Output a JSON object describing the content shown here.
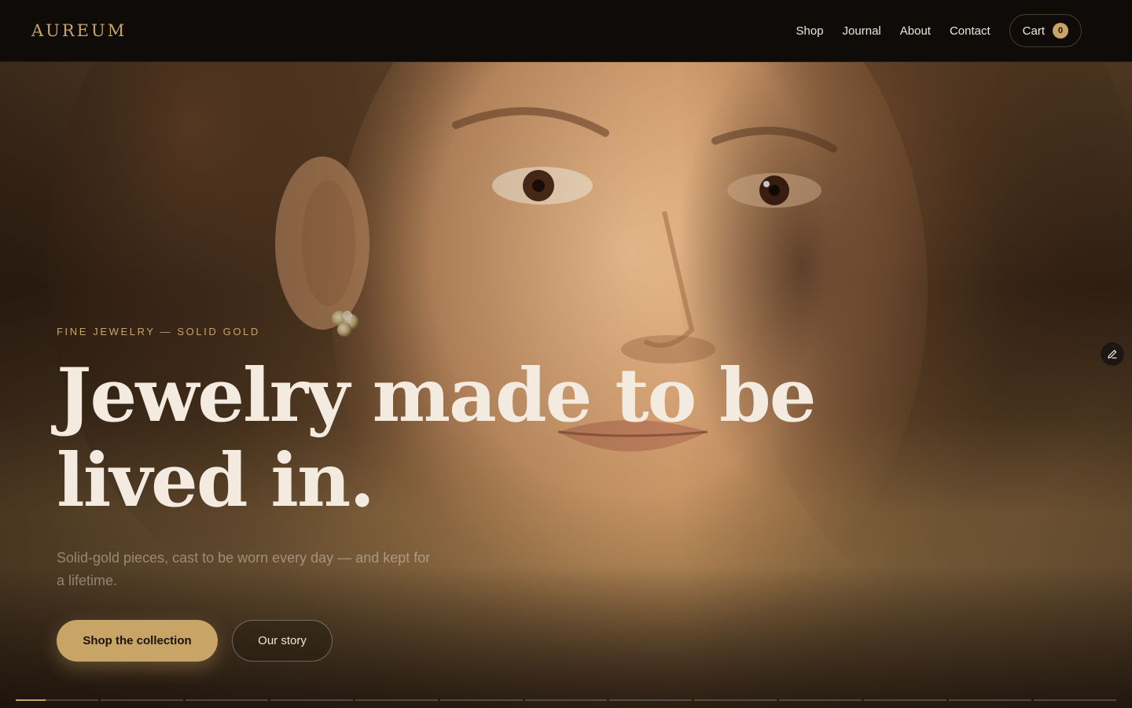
{
  "brand": {
    "logo": "AUREUM",
    "accent": "#c9a467",
    "background": "#0f0b08"
  },
  "nav": {
    "links": [
      "Shop",
      "Journal",
      "About",
      "Contact"
    ],
    "cart_label": "Cart",
    "cart_count": "0"
  },
  "hero": {
    "eyebrow": "FINE JEWELRY — SOLID GOLD",
    "headline": "Jewelry made to be lived in.",
    "subtitle": "Solid-gold pieces, cast to be worn every day — and kept for a lifetime.",
    "primary_cta": "Shop the collection",
    "secondary_cta": "Our story",
    "image": "portrait of woman wearing gold stud earring",
    "edit_icon": "pencil-icon"
  },
  "slides": {
    "count": 13,
    "active_index": 0,
    "active_progress": 0.36
  }
}
